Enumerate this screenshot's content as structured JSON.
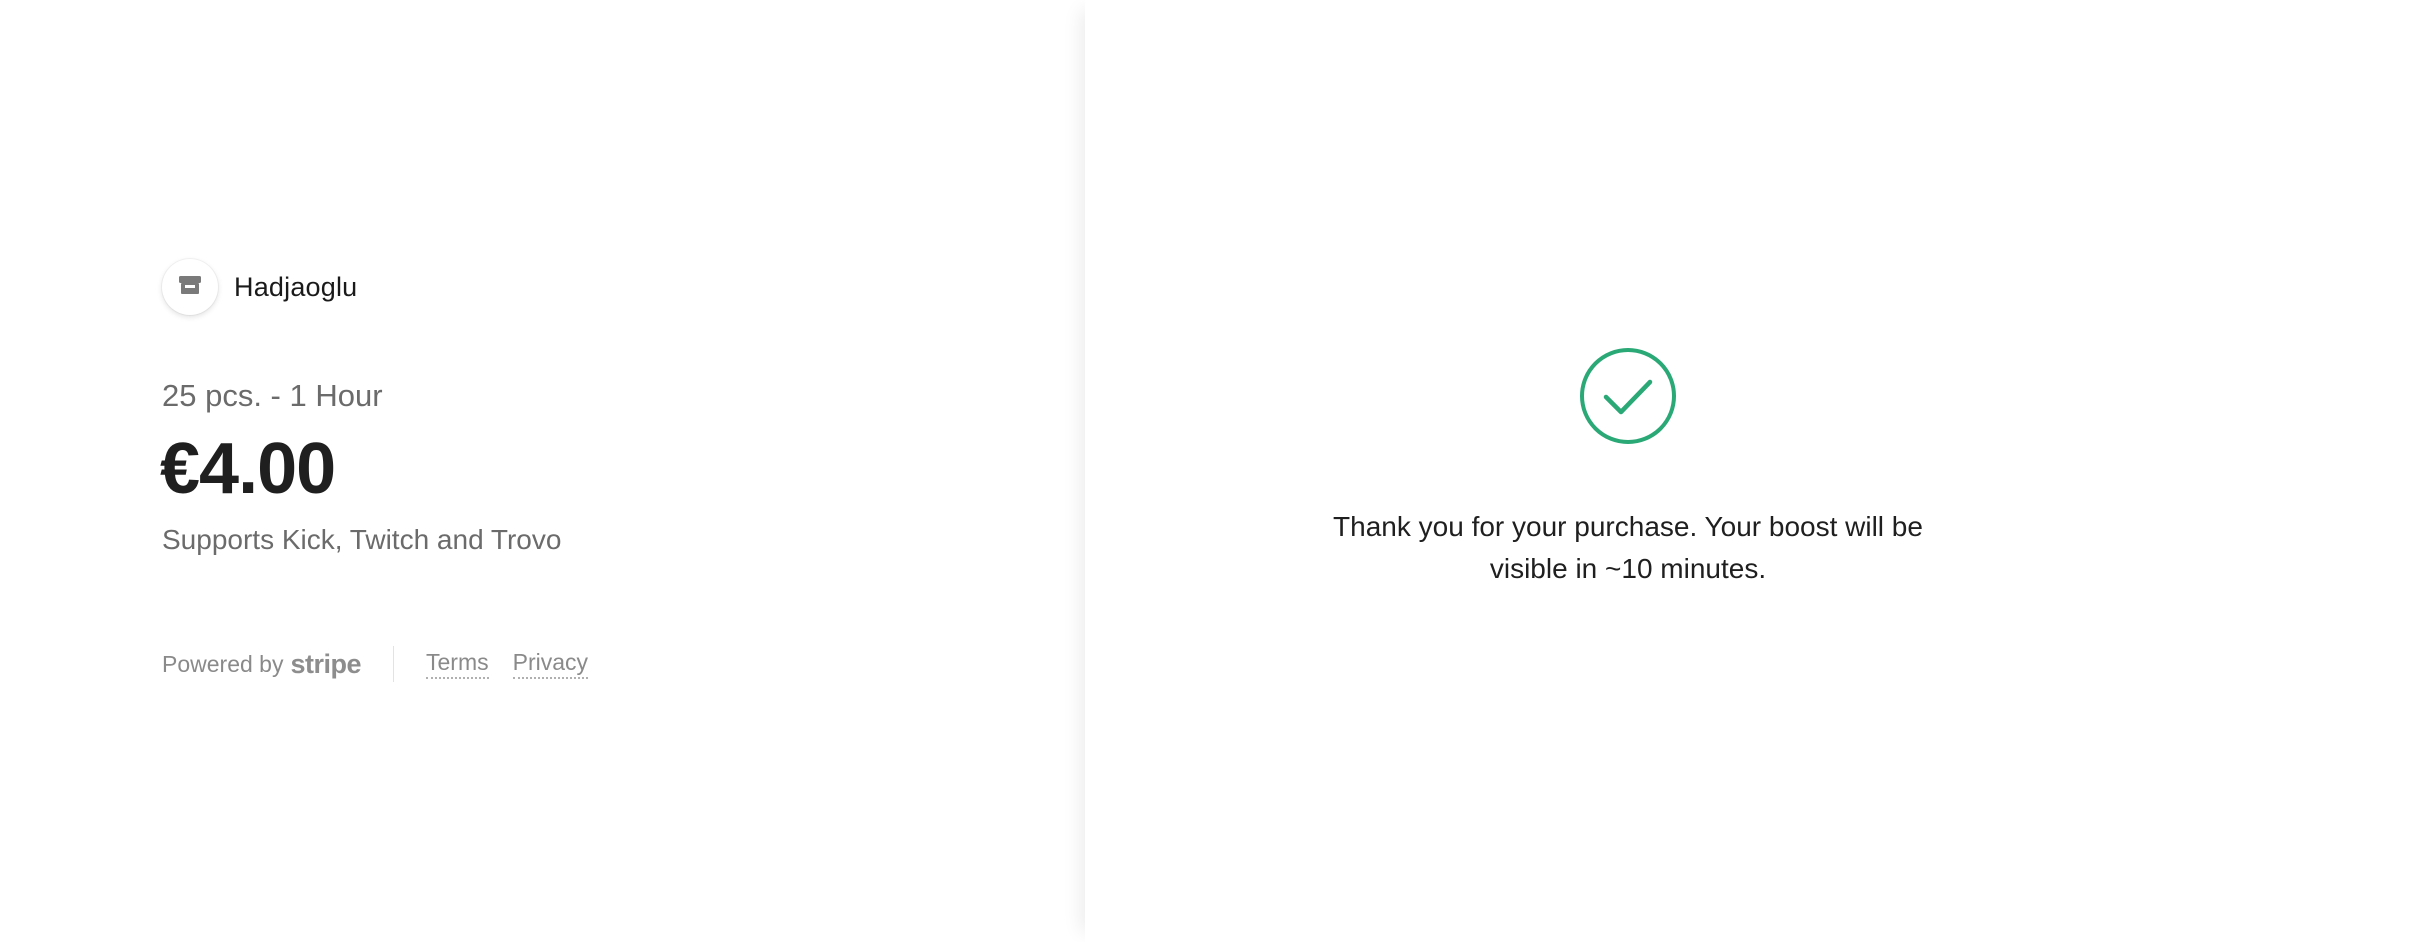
{
  "merchant": {
    "name": "Hadjaoglu",
    "icon": "store-icon"
  },
  "product": {
    "name": "25 pcs. - 1 Hour",
    "price": "€4.00",
    "description": "Supports Kick, Twitch and Trovo"
  },
  "footer": {
    "powered_by": "Powered by",
    "brand": "stripe",
    "terms": "Terms",
    "privacy": "Privacy"
  },
  "confirmation": {
    "icon": "check-circle-icon",
    "message": "Thank you for your purchase. Your boost will be visible in ~10 minutes."
  },
  "colors": {
    "success": "#2aa876",
    "text_primary": "#1a1a1a",
    "text_secondary": "#6b6b6b"
  }
}
